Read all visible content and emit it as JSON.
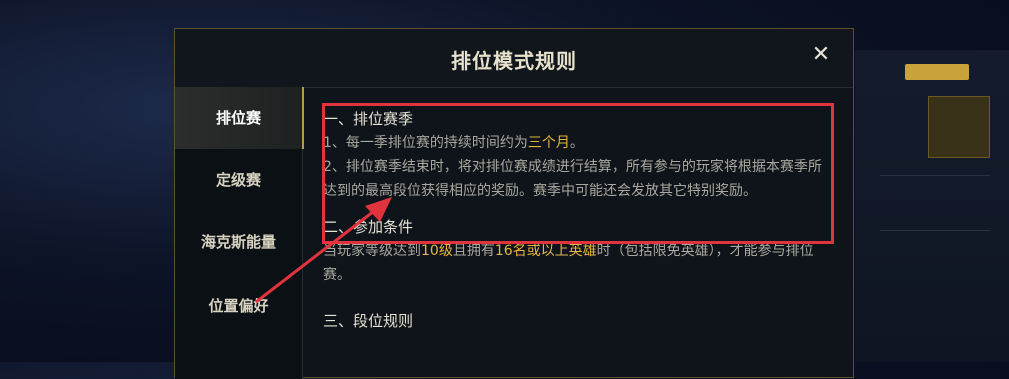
{
  "modal": {
    "title": "排位模式规则",
    "close_glyph": "✕"
  },
  "sidebar": {
    "items": [
      {
        "label": "排位赛",
        "active": true
      },
      {
        "label": "定级赛",
        "active": false
      },
      {
        "label": "海克斯能量",
        "active": false
      },
      {
        "label": "位置偏好",
        "active": false
      }
    ]
  },
  "content": {
    "s1": {
      "title": "一、排位赛季",
      "p1_pre": "1、每一季排位赛的持续时间约为",
      "p1_hl": "三个月",
      "p1_post": "。",
      "p2": "2、排位赛季结束时，将对排位赛成绩进行结算，所有参与的玩家将根据本赛季所达到的最高段位获得相应的奖励。赛季中可能还会发放其它特别奖励。"
    },
    "s2": {
      "title": "二、参加条件",
      "p_a": "当玩家等级达到",
      "p_hl1": "10级",
      "p_b": "且拥有",
      "p_hl2": "16名或以上英雄",
      "p_c": "时（包括限免英雄），才能参与排位赛。"
    },
    "s3": {
      "title": "三、段位规则"
    }
  },
  "colors": {
    "annotation": "#e0333d",
    "highlight_text": "#e6b640",
    "active_accent": "#b89a52"
  }
}
